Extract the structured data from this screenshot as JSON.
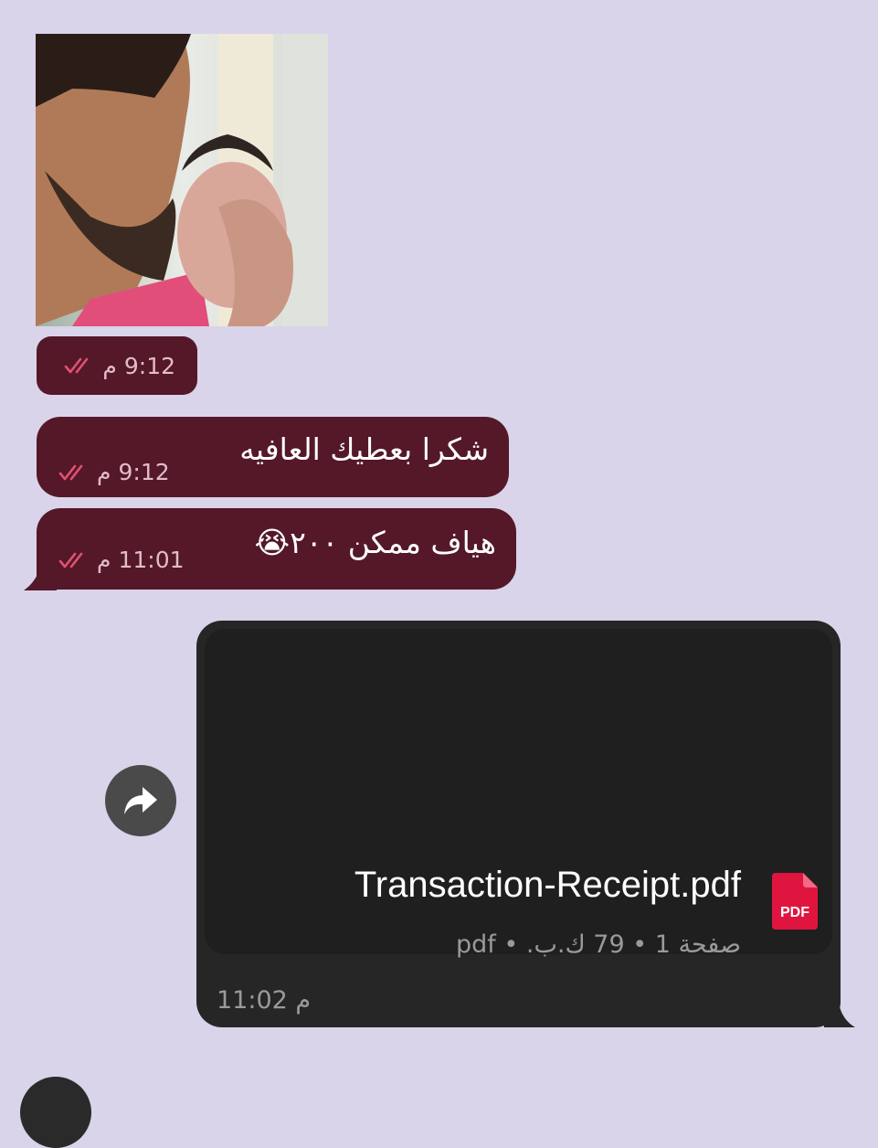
{
  "messages": [
    {
      "type": "photo",
      "time": "9:12",
      "ampm": "م"
    },
    {
      "type": "text",
      "text": "شكرا بعطيك العافيه",
      "time": "9:12",
      "ampm": "م"
    },
    {
      "type": "text",
      "text": "هياف ممكن ٢٠٠😭",
      "time": "11:01",
      "ampm": "م"
    }
  ],
  "document": {
    "file_name": "Transaction-Receipt.pdf",
    "info": "صفحة 1 • 79 ك.ب. • pdf",
    "icon_label": "PDF",
    "time": "11:02",
    "ampm": "م"
  },
  "colors": {
    "background": "#d9d4ea",
    "incoming_bubble": "#541829",
    "read_ticks": "#e0526f",
    "document_bubble": "#262626"
  },
  "icons": [
    "double-check-icon",
    "share-forward-icon",
    "pdf-file-icon"
  ]
}
